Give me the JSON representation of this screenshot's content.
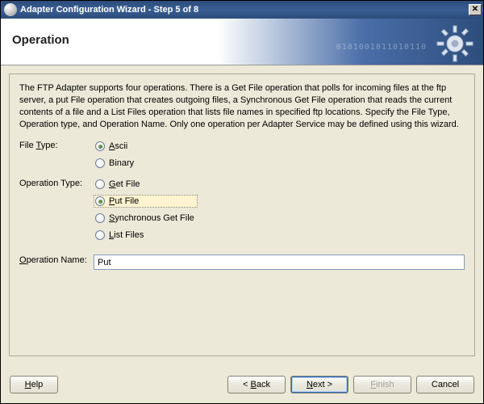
{
  "window": {
    "title": "Adapter Configuration Wizard - Step 5 of 8",
    "close_glyph": "✕"
  },
  "header": {
    "title": "Operation",
    "digits": "0101001011010110"
  },
  "desc": "The FTP Adapter supports four operations.  There is a Get File operation that polls for incoming files at the ftp server, a put File operation that creates outgoing files, a Synchronous Get File operation that reads the current contents of a file and a List Files operation that lists file names in specified ftp locations.  Specify the File Type, Operation type, and Operation Name.  Only one operation per Adapter Service may be defined using this wizard.",
  "file_type": {
    "label_pre": "File ",
    "label_ul": "T",
    "label_post": "ype:",
    "options": [
      {
        "ul": "A",
        "rest": "scii",
        "checked": true
      },
      {
        "ul": "",
        "rest": "Binary",
        "checked": false
      }
    ]
  },
  "op_type": {
    "label": "Operation Type:",
    "options": [
      {
        "ul": "G",
        "rest": "et File",
        "checked": false,
        "focused": false
      },
      {
        "ul": "P",
        "rest": "ut File",
        "checked": true,
        "focused": true
      },
      {
        "ul": "S",
        "rest": "ynchronous Get File",
        "checked": false,
        "focused": false
      },
      {
        "ul": "L",
        "rest": "ist Files",
        "checked": false,
        "focused": false
      }
    ]
  },
  "op_name": {
    "label_ul": "O",
    "label_rest": "peration Name:",
    "value": "Put"
  },
  "buttons": {
    "help": "Help",
    "back_pre": "< ",
    "back_ul": "B",
    "back_post": "ack",
    "next_ul": "N",
    "next_post": "ext >",
    "finish_ul": "F",
    "finish_post": "inish",
    "cancel": "Cancel"
  }
}
